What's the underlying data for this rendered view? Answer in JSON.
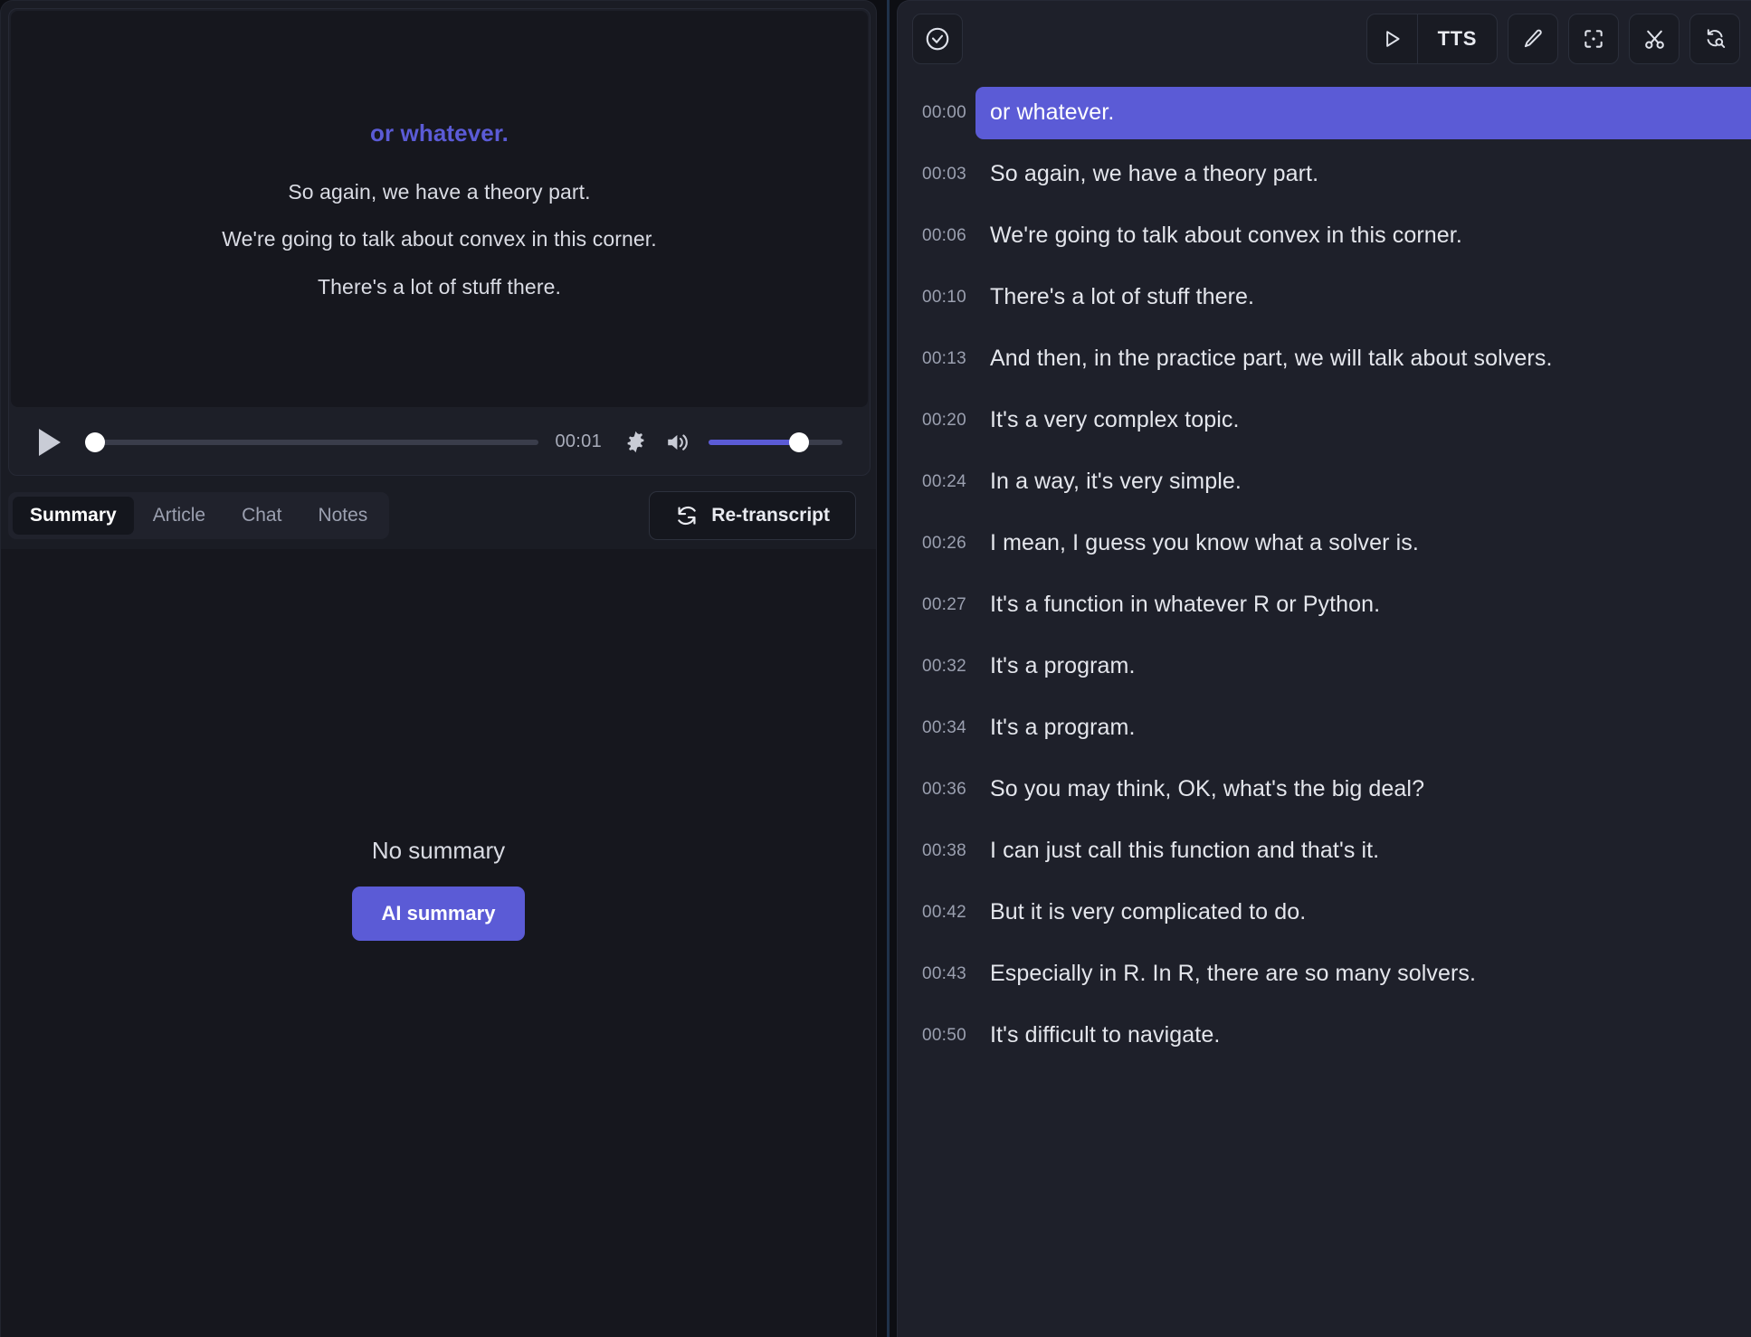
{
  "player": {
    "subtitles": [
      {
        "text": "or whatever.",
        "active": true
      },
      {
        "text": "So again, we have a theory part.",
        "active": false
      },
      {
        "text": "We're going to talk about convex in this corner.",
        "active": false
      },
      {
        "text": "There's a lot of stuff there.",
        "active": false
      }
    ],
    "current_time": "00:01",
    "play_icon": "play-icon",
    "settings_icon": "gear-icon",
    "volume_icon": "volume-icon",
    "volume_percent": 68,
    "seek_percent": 0
  },
  "tabs": [
    {
      "label": "Summary",
      "active": true
    },
    {
      "label": "Article",
      "active": false
    },
    {
      "label": "Chat",
      "active": false
    },
    {
      "label": "Notes",
      "active": false
    }
  ],
  "retranscript": {
    "label": "Re-transcript",
    "icon": "refresh-icon"
  },
  "summary_panel": {
    "empty_text": "No summary",
    "action_label": "AI summary"
  },
  "toolbar": {
    "select_all": {
      "icon": "check-circle-icon"
    },
    "tts": {
      "play_icon": "play-outline-icon",
      "label": "TTS"
    },
    "edit": {
      "icon": "pencil-icon"
    },
    "focus": {
      "icon": "focus-frame-icon"
    },
    "cut": {
      "icon": "scissors-icon"
    },
    "retry": {
      "icon": "refresh-search-icon"
    }
  },
  "transcript": [
    {
      "time": "00:00",
      "text": "or whatever.",
      "active": true
    },
    {
      "time": "00:03",
      "text": "So again, we have a theory part.",
      "active": false
    },
    {
      "time": "00:06",
      "text": "We're going to talk about convex in this corner.",
      "active": false
    },
    {
      "time": "00:10",
      "text": "There's a lot of stuff there.",
      "active": false
    },
    {
      "time": "00:13",
      "text": "And then, in the practice part, we will talk about solvers.",
      "active": false
    },
    {
      "time": "00:20",
      "text": "It's a very complex topic.",
      "active": false
    },
    {
      "time": "00:24",
      "text": "In a way, it's very simple.",
      "active": false
    },
    {
      "time": "00:26",
      "text": "I mean, I guess you know what a solver is.",
      "active": false
    },
    {
      "time": "00:27",
      "text": "It's a function in whatever R or Python.",
      "active": false
    },
    {
      "time": "00:32",
      "text": "It's a program.",
      "active": false
    },
    {
      "time": "00:34",
      "text": "It's a program.",
      "active": false
    },
    {
      "time": "00:36",
      "text": "So you may think, OK, what's the big deal?",
      "active": false
    },
    {
      "time": "00:38",
      "text": "I can just call this function and that's it.",
      "active": false
    },
    {
      "time": "00:42",
      "text": "But it is very complicated to do.",
      "active": false
    },
    {
      "time": "00:43",
      "text": "Especially in R. In R, there are so many solvers.",
      "active": false
    },
    {
      "time": "00:50",
      "text": "It's difficult to navigate.",
      "active": false
    }
  ],
  "colors": {
    "accent": "#5b5bd6",
    "panel_bg": "#1e202a",
    "left_bg": "#1a1c24",
    "stage_bg": "#16171e",
    "text_primary": "#e4e6ec",
    "text_muted": "#9ba0b0"
  }
}
